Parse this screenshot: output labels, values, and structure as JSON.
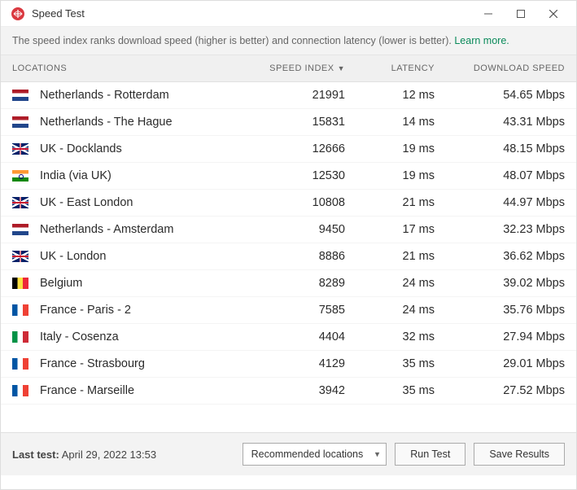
{
  "window": {
    "title": "Speed Test"
  },
  "info": {
    "text": "The speed index ranks download speed (higher is better) and connection latency (lower is better). ",
    "link": "Learn more."
  },
  "columns": {
    "locations": "LOCATIONS",
    "speed_index": "SPEED INDEX",
    "latency": "LATENCY",
    "download": "DOWNLOAD SPEED"
  },
  "rows": [
    {
      "flag": "nl",
      "name": "Netherlands - Rotterdam",
      "index": "21991",
      "latency": "12 ms",
      "download": "54.65 Mbps"
    },
    {
      "flag": "nl",
      "name": "Netherlands - The Hague",
      "index": "15831",
      "latency": "14 ms",
      "download": "43.31 Mbps"
    },
    {
      "flag": "uk",
      "name": "UK - Docklands",
      "index": "12666",
      "latency": "19 ms",
      "download": "48.15 Mbps"
    },
    {
      "flag": "in",
      "name": "India (via UK)",
      "index": "12530",
      "latency": "19 ms",
      "download": "48.07 Mbps"
    },
    {
      "flag": "uk",
      "name": "UK - East London",
      "index": "10808",
      "latency": "21 ms",
      "download": "44.97 Mbps"
    },
    {
      "flag": "nl",
      "name": "Netherlands - Amsterdam",
      "index": "9450",
      "latency": "17 ms",
      "download": "32.23 Mbps"
    },
    {
      "flag": "uk",
      "name": "UK - London",
      "index": "8886",
      "latency": "21 ms",
      "download": "36.62 Mbps"
    },
    {
      "flag": "be",
      "name": "Belgium",
      "index": "8289",
      "latency": "24 ms",
      "download": "39.02 Mbps"
    },
    {
      "flag": "fr",
      "name": "France - Paris - 2",
      "index": "7585",
      "latency": "24 ms",
      "download": "35.76 Mbps"
    },
    {
      "flag": "it",
      "name": "Italy - Cosenza",
      "index": "4404",
      "latency": "32 ms",
      "download": "27.94 Mbps"
    },
    {
      "flag": "fr",
      "name": "France - Strasbourg",
      "index": "4129",
      "latency": "35 ms",
      "download": "29.01 Mbps"
    },
    {
      "flag": "fr",
      "name": "France - Marseille",
      "index": "3942",
      "latency": "35 ms",
      "download": "27.52 Mbps"
    }
  ],
  "footer": {
    "label_prefix": "Last test:",
    "timestamp": "April 29, 2022 13:53",
    "dropdown_selected": "Recommended locations",
    "run_test": "Run Test",
    "save_results": "Save Results"
  }
}
